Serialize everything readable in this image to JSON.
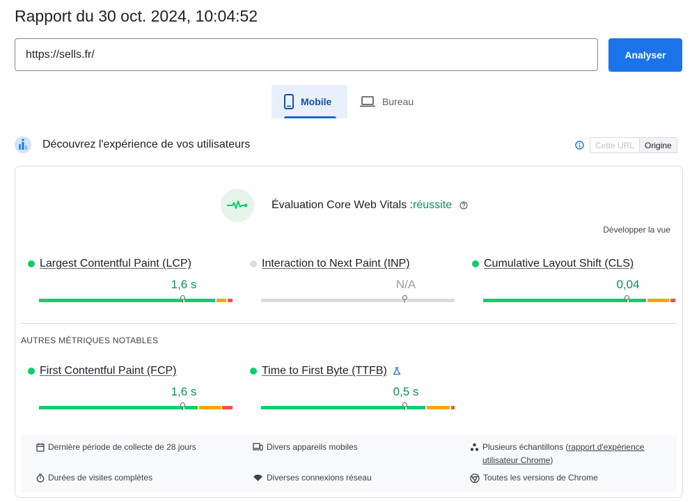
{
  "report": {
    "title": "Rapport du 30 oct. 2024, 10:04:52"
  },
  "search": {
    "url_value": "https://sells.fr/",
    "analyze_label": "Analyser"
  },
  "tabs": [
    {
      "label": "Mobile",
      "icon": "smartphone-icon",
      "active": true
    },
    {
      "label": "Bureau",
      "icon": "laptop-icon",
      "active": false
    }
  ],
  "crux": {
    "title": "Découvrez l'expérience de vos utilisateurs",
    "toggle": {
      "url_label": "Cette URL",
      "origin_label": "Origine",
      "selected": "Origine"
    }
  },
  "cwv": {
    "label": "Évaluation Core Web Vitals :",
    "result": "réussite",
    "expand_label": "Développer la vue"
  },
  "metrics": [
    {
      "name": "Largest Contentful Paint (LCP)",
      "value": "1,6 s",
      "status": "good"
    },
    {
      "name": "Interaction to Next Paint (INP)",
      "value": "N/A",
      "status": "none"
    },
    {
      "name": "Cumulative Layout Shift (CLS)",
      "value": "0,04",
      "status": "good"
    }
  ],
  "other": {
    "heading": "AUTRES MÉTRIQUES NOTABLES",
    "metrics": [
      {
        "name": "First Contentful Paint (FCP)",
        "value": "1,6 s",
        "status": "good"
      },
      {
        "name": "Time to First Byte (TTFB)",
        "value": "0,5 s",
        "status": "good",
        "experimental_icon": "flask-icon"
      }
    ]
  },
  "footer": {
    "period": "Dernière période de collecte de 28 jours",
    "devices": "Divers appareils mobiles",
    "samples_prefix": "Plusieurs échantillons (",
    "samples_link": "rapport d'expérience utilisateur Chrome",
    "samples_suffix": ")",
    "durations": "Durées de visites complètes",
    "network": "Diverses connexions réseau",
    "chrome": "Toutes les versions de Chrome"
  },
  "colors": {
    "accent": "#1a73e8",
    "good": "#0cce6b",
    "good_text": "#0d904f",
    "average": "#ffa400",
    "poor": "#ff4e42",
    "none": "#dadce0"
  }
}
